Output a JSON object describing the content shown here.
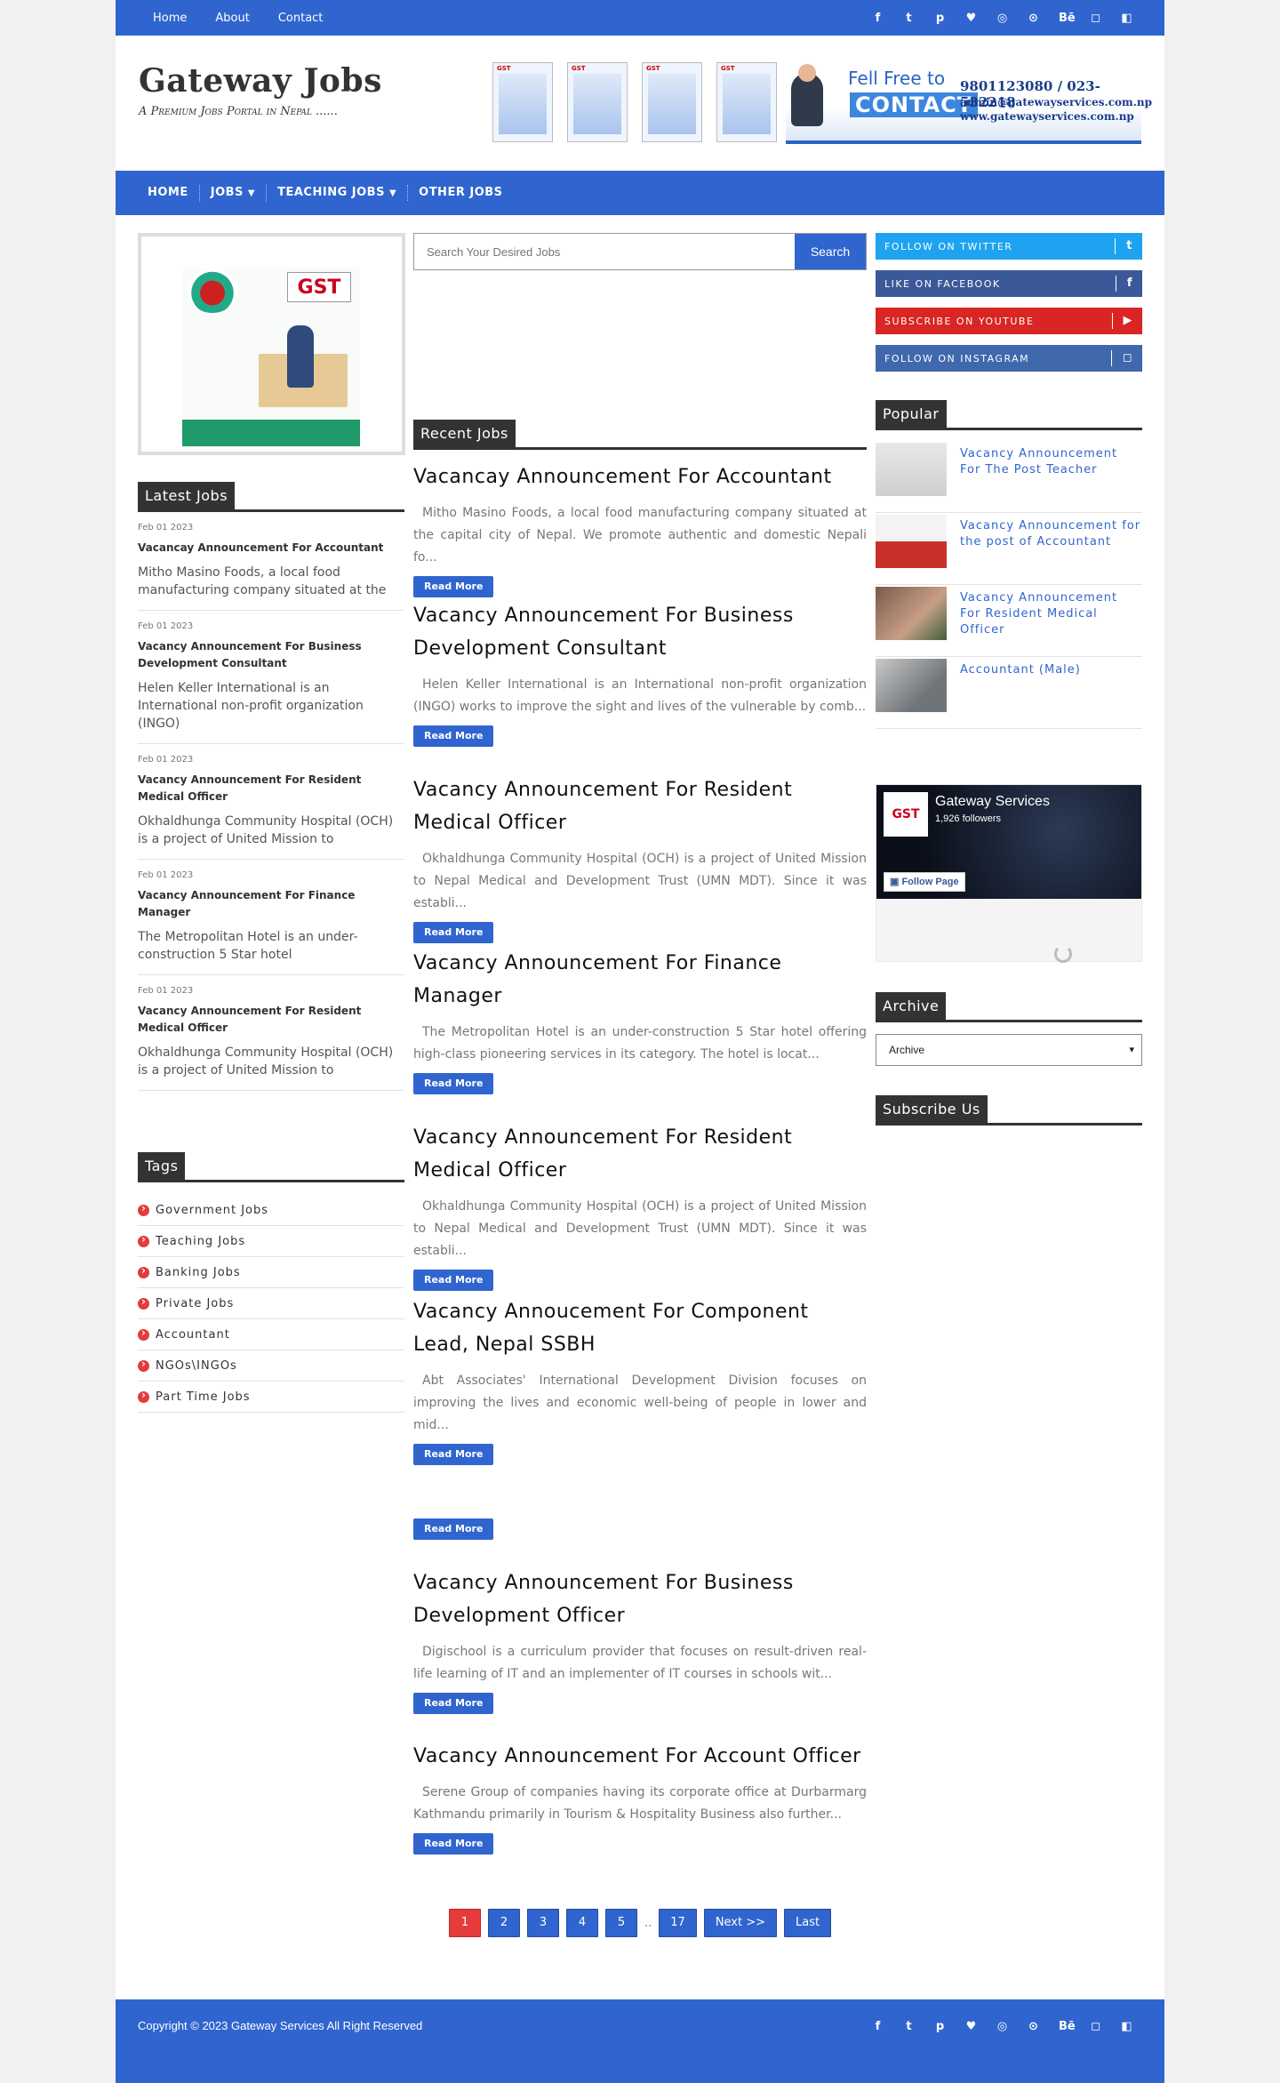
{
  "topnav": [
    "Home",
    "About",
    "Contact"
  ],
  "social_icons": [
    "facebook-icon",
    "twitter-icon",
    "pinterest-icon",
    "heart-icon",
    "dribbble-icon",
    "rss-icon",
    "behance-icon",
    "instagram-icon",
    "delicious-icon"
  ],
  "social_glyphs": [
    "f",
    "t",
    "p",
    "♥",
    "◎",
    "⊙",
    "Bē",
    "◻",
    "◧"
  ],
  "brand": {
    "title": "Gateway Jobs",
    "tagline": "A Premium Jobs Portal in Nepal ......"
  },
  "banner": {
    "fell": "Fell Free to",
    "contact": "CONTACT",
    "phone": "9801123080 / 023-532218",
    "email": "admin@gatewayservices.com.np",
    "web": "www.gatewayservices.com.np",
    "gst": "GST"
  },
  "mainnav": {
    "home": "HOME",
    "jobs": "JOBS",
    "teaching": "TEACHING JOBS",
    "other": "OTHER JOBS"
  },
  "search": {
    "placeholder": "Search Your Desired Jobs",
    "button": "Search"
  },
  "sections": {
    "latest": "Latest Jobs",
    "tags": "Tags",
    "recent": "Recent Jobs",
    "popular": "Popular",
    "archive": "Archive",
    "subscribe": "Subscribe Us"
  },
  "latest_jobs": [
    {
      "date": "Feb 01 2023",
      "title": "Vacancay Announcement For Accountant",
      "snippet": "Mitho Masino Foods, a local food manufacturing company situated at the"
    },
    {
      "date": "Feb 01 2023",
      "title": "Vacancy Announcement For Business Development Consultant",
      "snippet": "Helen Keller International is an International non-profit organization (INGO)"
    },
    {
      "date": "Feb 01 2023",
      "title": "Vacancy Announcement For Resident Medical Officer",
      "snippet": "Okhaldhunga Community Hospital (OCH) is a project of United Mission to"
    },
    {
      "date": "Feb 01 2023",
      "title": "Vacancy Announcement For Finance Manager",
      "snippet": "The Metropolitan Hotel is an under-construction 5 Star hotel"
    },
    {
      "date": "Feb 01 2023",
      "title": "Vacancy Announcement For Resident Medical Officer",
      "snippet": "Okhaldhunga Community Hospital (OCH) is a project of United Mission to"
    }
  ],
  "tags": [
    "Government Jobs",
    "Teaching Jobs",
    "Banking Jobs",
    "Private Jobs",
    "Accountant",
    "NGOs\\INGOs",
    "Part Time Jobs"
  ],
  "posts": [
    {
      "title": "Vacancay Announcement For Accountant",
      "excerpt": "Mitho Masino Foods, a local food manufacturing company situated at the capital city of Nepal.  We promote authentic and domestic Nepali fo...",
      "read_more": "Read More"
    },
    {
      "title": "Vacancy Announcement For Business Development Consultant",
      "excerpt": "Helen Keller International is an International non-profit organization (INGO) works to improve the sight and lives of the vulnerable by comb...",
      "read_more": "Read More"
    },
    {
      "title": "Vacancy Announcement For Resident Medical Officer",
      "excerpt": "Okhaldhunga Community Hospital (OCH) is a project of United Mission to Nepal Medical and Development Trust (UMN MDT). Since it was establi...",
      "read_more": "Read More"
    },
    {
      "title": "Vacancy Announcement For Finance Manager",
      "excerpt": "The Metropolitan Hotel   is an under-construction 5 Star hotel offering high-class pioneering services in its category. The hotel is locat...",
      "read_more": "Read More"
    },
    {
      "title": "Vacancy Announcement For Resident Medical Officer",
      "excerpt": "Okhaldhunga Community Hospital (OCH) is a project of United Mission to Nepal Medical and Development Trust (UMN MDT). Since it was establi...",
      "read_more": "Read More"
    },
    {
      "title": "Vacancy Annoucement For Component Lead, Nepal SSBH",
      "excerpt": "Abt Associates'    International Development Division focuses on improving the lives and economic well-being of people in lower and mid...",
      "read_more": "Read More"
    },
    {
      "title": "",
      "excerpt": "",
      "read_more": "Read More"
    },
    {
      "title": "Vacancy Announcement For Business Development Officer",
      "excerpt": "Digischool is a curriculum provider that focuses on result-driven real-life learning of IT and an implementer of IT courses in schools wit...",
      "read_more": "Read More"
    },
    {
      "title": "Vacancy Announcement For Account Officer",
      "excerpt": "Serene Group of companies having its corporate office at Durbarmarg Kathmandu primarily in Tourism & Hospitality Business also further...",
      "read_more": "Read More"
    }
  ],
  "pagination": {
    "pages": [
      "1",
      "2",
      "3",
      "4",
      "5"
    ],
    "ellipsis": "..",
    "last_page": "17",
    "next": "Next >>",
    "last": "Last",
    "current": "1"
  },
  "follow": [
    {
      "label": "FOLLOW ON TWITTER",
      "icon": "twitter-icon",
      "glyph": "t"
    },
    {
      "label": "LIKE ON FACEBOOK",
      "icon": "facebook-icon",
      "glyph": "f"
    },
    {
      "label": "SUBSCRIBE ON YOUTUBE",
      "icon": "youtube-icon",
      "glyph": "▶"
    },
    {
      "label": "FOLLOW ON INSTAGRAM",
      "icon": "instagram-icon",
      "glyph": "◻"
    }
  ],
  "popular": [
    "Vacancy Announcement For The Post Teacher",
    "Vacancy Announcement for the post of Accountant",
    "Vacancy Announcement For Resident Medical Officer",
    "Accountant (Male)"
  ],
  "facebook": {
    "name": "Gateway Services",
    "followers": "1,926 followers",
    "button": "Follow Page",
    "logo": "GST"
  },
  "archive": {
    "selected": "Archive"
  },
  "footer": {
    "copyright": "Copyright © 2023 Gateway Services All Right Reserved"
  },
  "colors": {
    "primary": "#3065cf",
    "accent_red": "#e53b3b",
    "twitter": "#1ea3f0",
    "facebook": "#3b5898",
    "youtube": "#d92524",
    "instagram": "#3f68ad"
  }
}
